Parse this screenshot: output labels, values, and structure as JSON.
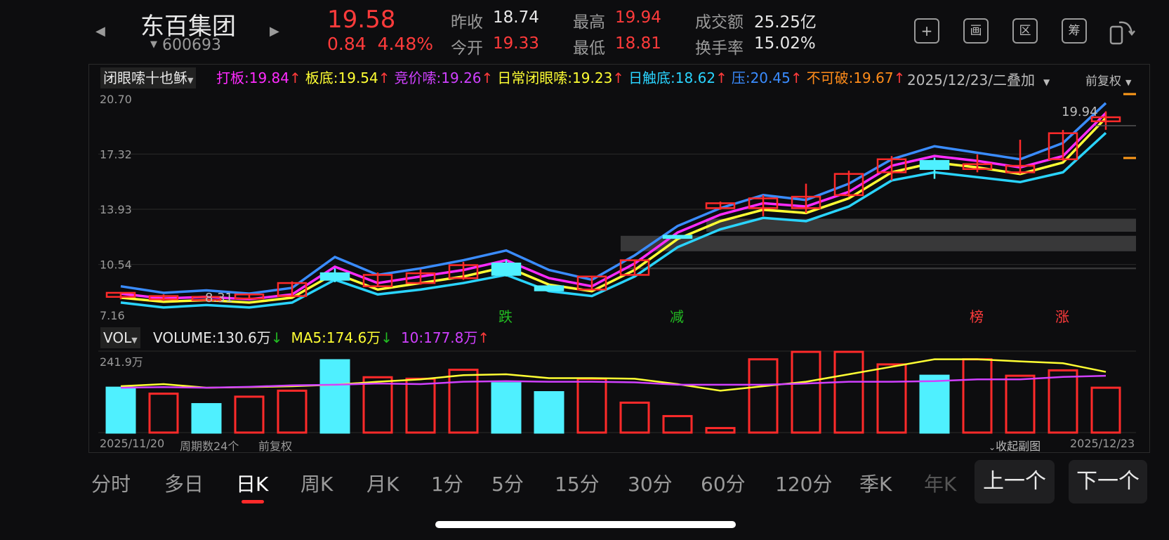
{
  "stock": {
    "name": "东百集团",
    "code": "600693",
    "price": "19.58",
    "change": "0.84",
    "change_pct": "4.48%",
    "prev_close_label": "昨收",
    "prev_close": "18.74",
    "open_label": "今开",
    "open": "19.33",
    "high_label": "最高",
    "high": "19.94",
    "low_label": "最低",
    "low": "18.81",
    "turnover_label": "成交额",
    "turnover": "25.25亿",
    "turnover_rate_label": "换手率",
    "turnover_rate": "15.02%"
  },
  "toolbar": {
    "icons": [
      "plus-icon",
      "draw-icon",
      "range-icon",
      "chip-icon",
      "rotate-icon"
    ],
    "labels": [
      "+",
      "画",
      "区",
      "筹",
      ""
    ]
  },
  "indicator": {
    "name": "闭眼嗦十也稣",
    "items": [
      {
        "text": "打板:19.84",
        "arrow": "↑",
        "color": "#ff2bff"
      },
      {
        "text": "板底:19.54",
        "arrow": "↑",
        "color": "#ffff33"
      },
      {
        "text": "竞价嗦:19.26",
        "arrow": "↑",
        "color": "#d040ff"
      },
      {
        "text": "日常闭眼嗦:19.23",
        "arrow": "↑",
        "color": "#ffff33"
      },
      {
        "text": "日触底:18.62",
        "arrow": "↑",
        "color": "#2ad4ff"
      },
      {
        "text": "压:20.45",
        "arrow": "↑",
        "color": "#3a8cff"
      },
      {
        "text": "不可破:19.67",
        "arrow": "↑",
        "color": "#ff8c1a"
      }
    ],
    "date_mode": "2025/12/23/二叠加",
    "adjust": "前复权"
  },
  "price_axis": [
    "20.70",
    "17.32",
    "13.93",
    "10.54",
    "7.16"
  ],
  "price_marks": {
    "high_label": "19.94",
    "low_label": "8.31"
  },
  "signals": [
    {
      "text": "跌",
      "color": "#22bb22"
    },
    {
      "text": "减",
      "color": "#22bb22"
    },
    {
      "text": "榜",
      "color": "#ff3b3b"
    },
    {
      "text": "涨",
      "color": "#ff3b3b"
    }
  ],
  "volume": {
    "name": "VOL",
    "items": [
      {
        "text": "VOLUME:130.6万",
        "arrow": "↓",
        "color": "#e8e8e8",
        "arrow_color": "#22bb22"
      },
      {
        "text": "MA5:174.6万",
        "arrow": "↓",
        "color": "#ffff33",
        "arrow_color": "#22bb22"
      },
      {
        "text": "10:177.8万",
        "arrow": "↑",
        "color": "#d040ff",
        "arrow_color": "#ff3b3b"
      }
    ],
    "max_label": "241.9万"
  },
  "footer": {
    "start_date": "2025/11/20",
    "period_count": "周期数24个",
    "adjust": "前复权",
    "collapse": "收起副图",
    "end_date": "2025/12/23"
  },
  "tabs": [
    "分时",
    "多日",
    "日K",
    "周K",
    "月K",
    "1分",
    "5分",
    "15分",
    "30分",
    "60分",
    "120分",
    "季K",
    "年K"
  ],
  "active_tab": "日K",
  "nav": {
    "prev": "上一个",
    "next": "下一个"
  },
  "chart_data": {
    "type": "candlestick",
    "ylim": [
      7.16,
      20.7
    ],
    "candles": [
      {
        "o": 8.55,
        "c": 8.8,
        "h": 8.85,
        "l": 8.4
      },
      {
        "o": 8.4,
        "c": 8.6,
        "h": 8.7,
        "l": 8.3
      },
      {
        "o": 8.35,
        "c": 8.55,
        "h": 8.6,
        "l": 8.31
      },
      {
        "o": 8.45,
        "c": 8.7,
        "h": 8.75,
        "l": 8.4
      },
      {
        "o": 8.6,
        "c": 9.4,
        "h": 9.5,
        "l": 8.55
      },
      {
        "o": 10.0,
        "c": 9.6,
        "h": 10.3,
        "l": 9.45
      },
      {
        "o": 9.2,
        "c": 9.9,
        "h": 10.05,
        "l": 9.15
      },
      {
        "o": 9.4,
        "c": 10.0,
        "h": 10.25,
        "l": 9.3
      },
      {
        "o": 9.7,
        "c": 10.5,
        "h": 10.7,
        "l": 9.6
      },
      {
        "o": 10.6,
        "c": 9.9,
        "h": 10.8,
        "l": 9.8
      },
      {
        "o": 9.2,
        "c": 8.95,
        "h": 9.3,
        "l": 8.9
      },
      {
        "o": 9.0,
        "c": 9.8,
        "h": 9.85,
        "l": 8.95
      },
      {
        "o": 9.9,
        "c": 10.8,
        "h": 10.85,
        "l": 9.85
      },
      {
        "o": 12.3,
        "c": 12.2,
        "h": 12.35,
        "l": 12.1
      },
      {
        "o": 14.0,
        "c": 14.3,
        "h": 14.4,
        "l": 13.9
      },
      {
        "o": 14.0,
        "c": 14.6,
        "h": 14.8,
        "l": 13.5
      },
      {
        "o": 14.0,
        "c": 14.7,
        "h": 15.5,
        "l": 13.7
      },
      {
        "o": 14.8,
        "c": 16.1,
        "h": 16.3,
        "l": 14.7
      },
      {
        "o": 16.2,
        "c": 17.0,
        "h": 17.2,
        "l": 15.7
      },
      {
        "o": 16.9,
        "c": 16.4,
        "h": 17.1,
        "l": 15.8
      },
      {
        "o": 16.4,
        "c": 16.7,
        "h": 17.3,
        "l": 16.2
      },
      {
        "o": 16.2,
        "c": 16.6,
        "h": 18.2,
        "l": 16.1
      },
      {
        "o": 17.0,
        "c": 18.6,
        "h": 18.8,
        "l": 16.9
      },
      {
        "o": 19.33,
        "c": 19.58,
        "h": 19.94,
        "l": 18.81
      }
    ],
    "up_color": "#ff2a2a",
    "down_color": "#4ff0ff",
    "lines": [
      {
        "name": "压",
        "color": "#3a8cff",
        "values": [
          9.2,
          8.8,
          8.95,
          8.75,
          9.1,
          11.0,
          9.9,
          10.3,
          10.8,
          11.4,
          10.2,
          9.6,
          11.1,
          12.9,
          14.0,
          14.8,
          14.5,
          15.5,
          17.0,
          17.8,
          17.4,
          17.0,
          18.0,
          20.45
        ]
      },
      {
        "name": "打板",
        "color": "#ff2bff",
        "values": [
          8.75,
          8.45,
          8.55,
          8.4,
          8.7,
          10.4,
          9.4,
          9.8,
          10.2,
          10.8,
          9.7,
          9.2,
          10.6,
          12.5,
          13.6,
          14.3,
          14.1,
          15.0,
          16.6,
          17.2,
          16.9,
          16.5,
          17.2,
          19.84
        ]
      },
      {
        "name": "板底",
        "color": "#ffff33",
        "values": [
          8.5,
          8.25,
          8.35,
          8.2,
          8.5,
          10.0,
          9.0,
          9.4,
          9.8,
          10.4,
          9.3,
          8.9,
          10.2,
          12.1,
          13.2,
          13.9,
          13.7,
          14.6,
          16.2,
          16.8,
          16.5,
          16.1,
          16.8,
          19.54
        ]
      },
      {
        "name": "日触底",
        "color": "#2ad4ff",
        "values": [
          8.2,
          7.9,
          8.05,
          7.9,
          8.2,
          9.6,
          8.7,
          9.0,
          9.4,
          9.9,
          8.9,
          8.6,
          9.8,
          11.6,
          12.7,
          13.4,
          13.2,
          14.1,
          15.7,
          16.2,
          15.9,
          15.6,
          16.2,
          18.62
        ]
      }
    ],
    "zones": [
      {
        "from": 12.55,
        "to": 13.35,
        "start": 14
      },
      {
        "from": 11.35,
        "to": 12.3,
        "start": 12
      },
      {
        "from": 10.25,
        "to": 10.35,
        "start": 12
      }
    ],
    "signal_positions": [
      9,
      13,
      20,
      22
    ],
    "volumes": [
      150,
      130,
      95,
      120,
      140,
      241.9,
      185,
      180,
      210,
      165,
      135,
      180,
      100,
      55,
      15,
      245,
      270,
      270,
      228,
      190,
      245,
      190,
      208,
      150
    ],
    "volume_up": [
      false,
      true,
      false,
      true,
      true,
      false,
      true,
      true,
      true,
      false,
      false,
      true,
      true,
      true,
      true,
      true,
      true,
      true,
      true,
      false,
      true,
      true,
      true,
      true
    ],
    "ma5": [
      155,
      162,
      150,
      152,
      155,
      160,
      170,
      178,
      192,
      195,
      182,
      182,
      180,
      162,
      140,
      155,
      170,
      195,
      220,
      245,
      245,
      238,
      232,
      203
    ],
    "ma10": [
      150,
      152,
      150,
      153,
      158,
      160,
      164,
      162,
      170,
      172,
      170,
      170,
      168,
      160,
      160,
      160,
      164,
      170,
      170,
      172,
      178,
      178,
      186,
      190
    ],
    "vol_max": 241.9
  }
}
